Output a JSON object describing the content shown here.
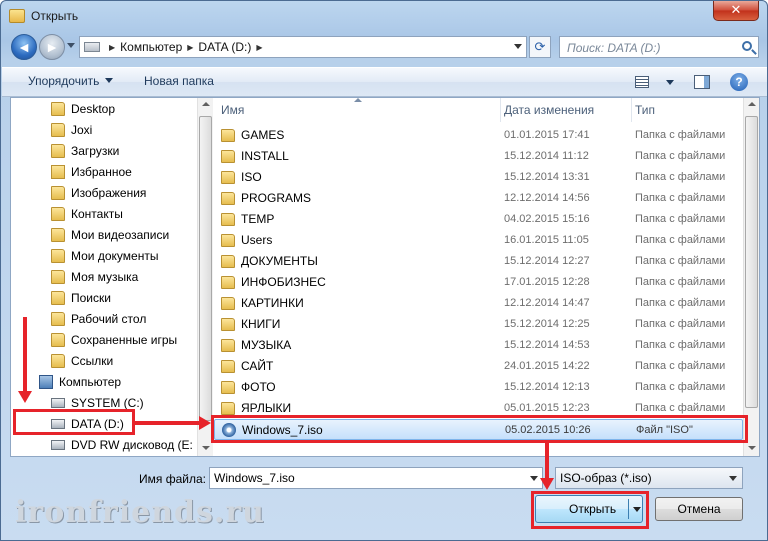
{
  "window": {
    "title": "Открыть",
    "close_glyph": "✕"
  },
  "address": {
    "crumbs": [
      "Компьютер",
      "DATA (D:)"
    ],
    "separator": "▶",
    "search_placeholder": "Поиск: DATA (D:)"
  },
  "nav_glyphs": {
    "back": "◄",
    "forward": "►",
    "refresh": "⟳"
  },
  "toolbar": {
    "organize": "Упорядочить",
    "new_folder": "Новая папка",
    "help": "?"
  },
  "nav_pane": {
    "items": [
      {
        "label": "Desktop",
        "icon": "folder-icon"
      },
      {
        "label": "Joxi",
        "icon": "folder-icon"
      },
      {
        "label": "Загрузки",
        "icon": "folder-icon"
      },
      {
        "label": "Избранное",
        "icon": "favorites-icon"
      },
      {
        "label": "Изображения",
        "icon": "folder-icon"
      },
      {
        "label": "Контакты",
        "icon": "folder-icon"
      },
      {
        "label": "Мои видеозаписи",
        "icon": "folder-icon"
      },
      {
        "label": "Мои документы",
        "icon": "folder-icon"
      },
      {
        "label": "Моя музыка",
        "icon": "folder-icon"
      },
      {
        "label": "Поиски",
        "icon": "folder-icon"
      },
      {
        "label": "Рабочий стол",
        "icon": "folder-icon"
      },
      {
        "label": "Сохраненные игры",
        "icon": "folder-icon"
      },
      {
        "label": "Ссылки",
        "icon": "folder-icon"
      },
      {
        "label": "Компьютер",
        "icon": "computer-icon"
      },
      {
        "label": "SYSTEM (C:)",
        "icon": "drive-icon"
      },
      {
        "label": "DATA (D:)",
        "icon": "drive-icon"
      },
      {
        "label": "DVD RW дисковод (E:",
        "icon": "dvd-drive-icon"
      }
    ]
  },
  "columns": {
    "name": "Имя",
    "date": "Дата изменения",
    "type": "Тип"
  },
  "files": [
    {
      "name": "GAMES",
      "date": "01.01.2015 17:41",
      "type": "Папка с файлами"
    },
    {
      "name": "INSTALL",
      "date": "15.12.2014 11:12",
      "type": "Папка с файлами"
    },
    {
      "name": "ISO",
      "date": "15.12.2014 13:31",
      "type": "Папка с файлами"
    },
    {
      "name": "PROGRAMS",
      "date": "12.12.2014 14:56",
      "type": "Папка с файлами"
    },
    {
      "name": "TEMP",
      "date": "04.02.2015 15:16",
      "type": "Папка с файлами"
    },
    {
      "name": "Users",
      "date": "16.01.2015 11:05",
      "type": "Папка с файлами"
    },
    {
      "name": "ДОКУМЕНТЫ",
      "date": "15.12.2014 12:27",
      "type": "Папка с файлами"
    },
    {
      "name": "ИНФОБИЗНЕС",
      "date": "17.01.2015 12:28",
      "type": "Папка с файлами"
    },
    {
      "name": "КАРТИНКИ",
      "date": "12.12.2014 14:47",
      "type": "Папка с файлами"
    },
    {
      "name": "КНИГИ",
      "date": "15.12.2014 12:25",
      "type": "Папка с файлами"
    },
    {
      "name": "МУЗЫКА",
      "date": "15.12.2014 14:53",
      "type": "Папка с файлами"
    },
    {
      "name": "САЙТ",
      "date": "24.01.2015 14:22",
      "type": "Папка с файлами"
    },
    {
      "name": "ФОТО",
      "date": "15.12.2014 12:13",
      "type": "Папка с файлами"
    },
    {
      "name": "ЯРЛЫКИ",
      "date": "05.01.2015 12:23",
      "type": "Папка с файлами"
    },
    {
      "name": "Windows_7.iso",
      "date": "05.02.2015 10:26",
      "type": "Файл \"ISO\"",
      "selected": true
    }
  ],
  "bottom": {
    "filename_label": "Имя файла:",
    "filename_value": "Windows_7.iso",
    "filetype_value": "ISO-образ (*.iso)",
    "open_button": "Открыть",
    "cancel_button": "Отмена"
  },
  "watermark": "ironfriends.ru",
  "colors": {
    "annotation_red": "#e6232a",
    "selection_bg": "#c5e0fb",
    "window_frame": "#a9c6e6"
  }
}
